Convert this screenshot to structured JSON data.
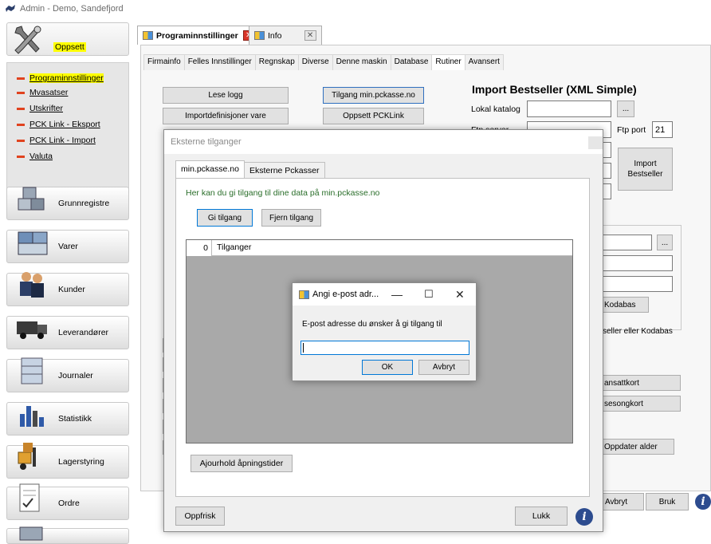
{
  "window": {
    "title": "Admin - Demo, Sandefjord"
  },
  "sidebar": {
    "oppsett_label": "Oppsett",
    "menu": [
      {
        "label": "Programinnstillinger"
      },
      {
        "label": "Mvasatser"
      },
      {
        "label": "Utskrifter"
      },
      {
        "label": "PCK Link - Eksport"
      },
      {
        "label": "PCK Link - Import"
      },
      {
        "label": "Valuta"
      }
    ],
    "nav": [
      {
        "label": "Grunnregistre"
      },
      {
        "label": "Varer"
      },
      {
        "label": "Kunder"
      },
      {
        "label": "Leverandører"
      },
      {
        "label": "Journaler"
      },
      {
        "label": "Statistikk"
      },
      {
        "label": "Lagerstyring"
      },
      {
        "label": "Ordre"
      }
    ]
  },
  "doc_tabs": [
    {
      "label": "Programinnstillinger"
    },
    {
      "label": "Info"
    }
  ],
  "sub_tabs": [
    {
      "label": "Firmainfo"
    },
    {
      "label": "Felles Innstillinger"
    },
    {
      "label": "Regnskap"
    },
    {
      "label": "Diverse"
    },
    {
      "label": "Denne maskin"
    },
    {
      "label": "Database"
    },
    {
      "label": "Rutiner"
    },
    {
      "label": "Avansert"
    }
  ],
  "rutiner": {
    "lese_logg": "Lese logg",
    "importdef": "Importdefinisjoner vare",
    "tilgang": "Tilgang min.pckasse.no",
    "oppsett_pcklink": "Oppsett PCKLink",
    "import_title": "Import Bestseller (XML Simple)",
    "lokal_katalog": "Lokal katalog",
    "browse": "...",
    "ftp_server": "Ftp server",
    "ftp_port_label": "Ftp port",
    "ftp_port_value": "21",
    "import_btn": "Import Bestseller",
    "kodabas_btn": "Kodabas",
    "kodabas_note": "seller eller Kodabas",
    "ansattkort": "ansattkort",
    "sesongkort": "sesongkort",
    "oppdater_alder": "Oppdater alder",
    "avbryt": "Avbryt",
    "bruk": "Bruk"
  },
  "dialog_eksterne": {
    "title": "Eksterne tilganger",
    "tabs": [
      {
        "label": "min.pckasse.no"
      },
      {
        "label": "Eksterne Pckasser"
      }
    ],
    "description": "Her kan du gi tilgang til dine data på min.pckasse.no",
    "gi_tilgang": "Gi tilgang",
    "fjern_tilgang": "Fjern tilgang",
    "grid_count": "0",
    "grid_header": "Tilganger",
    "ajourhold": "Ajourhold åpningstider",
    "oppfrisk": "Oppfrisk",
    "lukk": "Lukk"
  },
  "dialog_epost": {
    "title": "Angi e-post adr...",
    "prompt": "E-post adresse du ønsker å gi tilgang til",
    "input_value": "",
    "ok": "OK",
    "avbryt": "Avbryt"
  },
  "colors": {
    "highlight": "#ffff00",
    "accent_red": "#e0431f",
    "desc_green": "#2a6e2a",
    "info_blue": "#2d4c8f"
  }
}
